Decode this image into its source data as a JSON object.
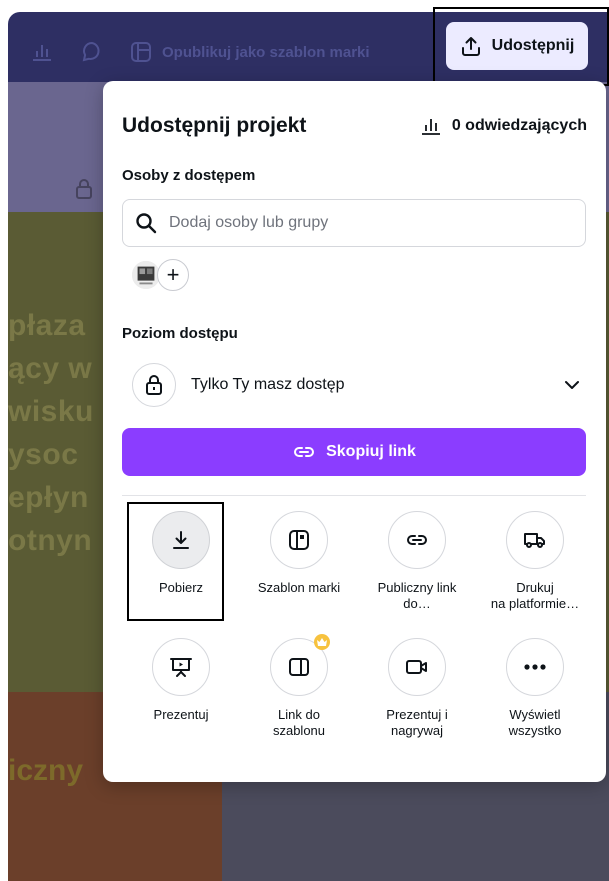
{
  "background": {
    "toolbar": {
      "publish_label": "Opublikuj jako szablon marki"
    },
    "text_lines": [
      "płaza",
      "ący w",
      "wisku",
      "ysoc",
      "epłyn",
      "otnyn"
    ],
    "bottom_text": "iczny"
  },
  "share_button": {
    "label": "Udostępnij",
    "icon": "upload-icon"
  },
  "panel": {
    "title": "Udostępnij projekt",
    "visitors": "0 odwiedzających",
    "people_label": "Osoby z dostępem",
    "search_placeholder": "Dodaj osoby lub grupy",
    "add_person": "+",
    "access_label": "Poziom dostępu",
    "access_value": "Tylko Ty masz dostęp",
    "copy_link": "Skopiuj link",
    "actions": [
      {
        "label": "Pobierz",
        "icon": "download-icon"
      },
      {
        "label": "Szablon marki",
        "icon": "brand-template-icon"
      },
      {
        "label": "Publiczny link do…",
        "icon": "link-icon"
      },
      {
        "label": "Drukuj na platformie…",
        "icon": "truck-icon"
      },
      {
        "label": "Prezentuj",
        "icon": "presentation-icon"
      },
      {
        "label": "Link do szablonu",
        "icon": "template-link-icon",
        "badge": "crown-icon"
      },
      {
        "label": "Prezentuj i nagrywaj",
        "icon": "video-camera-icon"
      },
      {
        "label": "Wyświetl wszystko",
        "icon": "more-icon"
      }
    ],
    "action_lines": {
      "public_link": [
        "Publiczny link",
        "do…"
      ],
      "print": [
        "Drukuj",
        "na platformie…"
      ],
      "template_link": [
        "Link do",
        "szablonu"
      ],
      "present_record": [
        "Prezentuj i",
        "nagrywaj"
      ],
      "show_all": [
        "Wyświetl",
        "wszystko"
      ]
    }
  },
  "colors": {
    "accent": "#8b3dff",
    "share_bg": "#ecebff",
    "crown": "#f7c23e"
  }
}
